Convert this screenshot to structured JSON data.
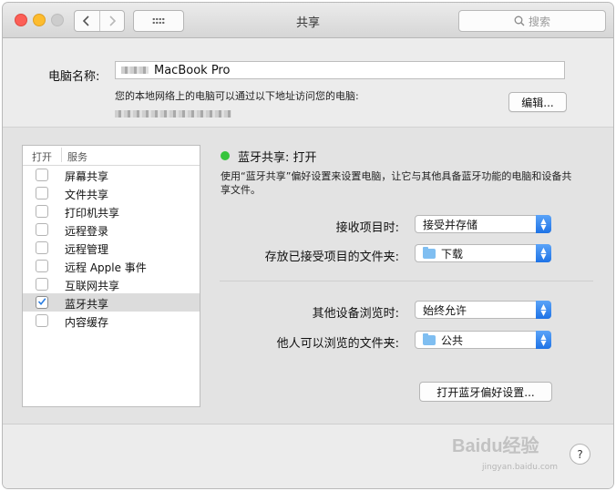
{
  "window": {
    "title": "共享"
  },
  "search": {
    "placeholder": "搜索"
  },
  "computer": {
    "name_label": "电脑名称:",
    "name_value": "MacBook Pro",
    "access_desc": "您的本地网络上的电脑可以通过以下地址访问您的电脑:",
    "edit_label": "编辑..."
  },
  "services": {
    "header_on": "打开",
    "header_service": "服务",
    "items": [
      {
        "label": "屏幕共享",
        "checked": false
      },
      {
        "label": "文件共享",
        "checked": false
      },
      {
        "label": "打印机共享",
        "checked": false
      },
      {
        "label": "远程登录",
        "checked": false
      },
      {
        "label": "远程管理",
        "checked": false
      },
      {
        "label": "远程 Apple 事件",
        "checked": false
      },
      {
        "label": "互联网共享",
        "checked": false
      },
      {
        "label": "蓝牙共享",
        "checked": true,
        "selected": true
      },
      {
        "label": "内容缓存",
        "checked": false
      }
    ]
  },
  "detail": {
    "status": "蓝牙共享: 打开",
    "description": "使用“蓝牙共享”偏好设置来设置电脑，让它与其他具备蓝牙功能的电脑和设备共享文件。",
    "receive_label": "接收项目时:",
    "receive_value": "接受并存储",
    "save_folder_label": "存放已接受项目的文件夹:",
    "save_folder_value": "下载",
    "browse_label": "其他设备浏览时:",
    "browse_value": "始终允许",
    "browse_folder_label": "他人可以浏览的文件夹:",
    "browse_folder_value": "公共",
    "open_prefs_label": "打开蓝牙偏好设置..."
  },
  "help": {
    "label": "?"
  },
  "watermark": {
    "text": "Baidu经验",
    "sub": "jingyan.baidu.com"
  },
  "colors": {
    "status_on": "#35c43c",
    "accent": "#1e73e6",
    "checkmark": "#2a7de1"
  }
}
